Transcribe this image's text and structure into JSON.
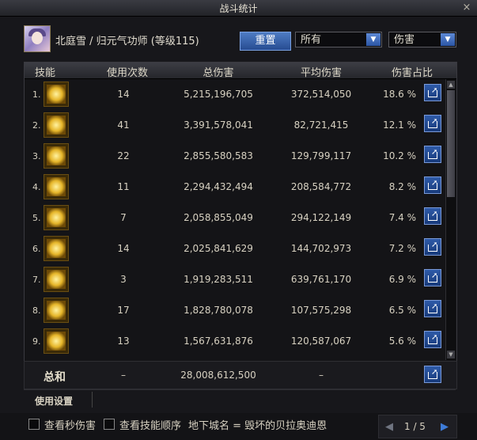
{
  "window": {
    "title": "战斗统计",
    "close": "×"
  },
  "header": {
    "character": "北庭雪 / 归元气功师 (等级115)",
    "reset_label": "重置",
    "filter1": "所有",
    "filter2": "伤害"
  },
  "columns": {
    "skill": "技能",
    "uses": "使用次数",
    "total": "总伤害",
    "avg": "平均伤害",
    "pct": "伤害占比"
  },
  "rows": [
    {
      "idx": "1.",
      "uses": "14",
      "total": "5,215,196,705",
      "avg": "372,514,050",
      "pct": "18.6 %"
    },
    {
      "idx": "2.",
      "uses": "41",
      "total": "3,391,578,041",
      "avg": "82,721,415",
      "pct": "12.1 %"
    },
    {
      "idx": "3.",
      "uses": "22",
      "total": "2,855,580,583",
      "avg": "129,799,117",
      "pct": "10.2 %"
    },
    {
      "idx": "4.",
      "uses": "11",
      "total": "2,294,432,494",
      "avg": "208,584,772",
      "pct": "8.2 %"
    },
    {
      "idx": "5.",
      "uses": "7",
      "total": "2,058,855,049",
      "avg": "294,122,149",
      "pct": "7.4 %"
    },
    {
      "idx": "6.",
      "uses": "14",
      "total": "2,025,841,629",
      "avg": "144,702,973",
      "pct": "7.2 %"
    },
    {
      "idx": "7.",
      "uses": "3",
      "total": "1,919,283,511",
      "avg": "639,761,170",
      "pct": "6.9 %"
    },
    {
      "idx": "8.",
      "uses": "17",
      "total": "1,828,780,078",
      "avg": "107,575,298",
      "pct": "6.5 %"
    },
    {
      "idx": "9.",
      "uses": "13",
      "total": "1,567,631,876",
      "avg": "120,587,067",
      "pct": "5.6 %"
    }
  ],
  "summary": {
    "label": "总和",
    "uses": "–",
    "total": "28,008,612,500",
    "avg": "–"
  },
  "settings": {
    "label": "使用设置"
  },
  "footer": {
    "opt1": "查看秒伤害",
    "opt2": "查看技能顺序",
    "dungeon": "地下城名 = 毁坏的贝拉奥迪恩",
    "page": "1 / 5"
  }
}
